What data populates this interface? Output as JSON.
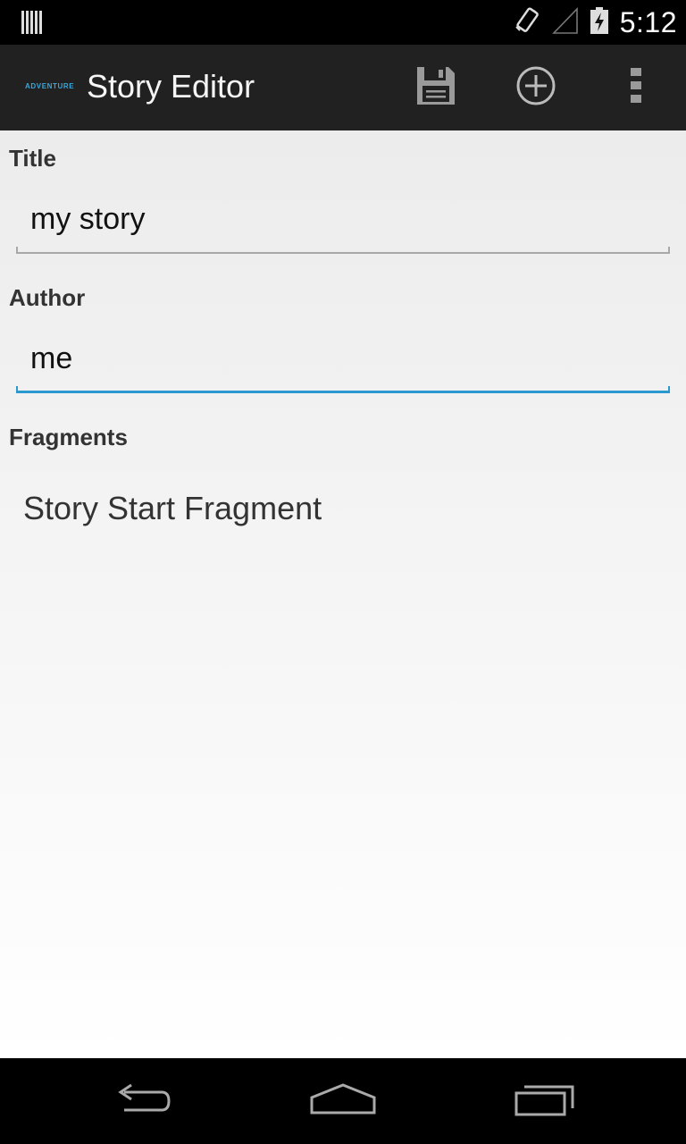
{
  "status_bar": {
    "time": "5:12",
    "icons": [
      "notification-icon",
      "vibrate-icon",
      "signal-icon",
      "battery-charging-icon"
    ]
  },
  "action_bar": {
    "logo_text": "ADVENTURE",
    "title": "Story Editor",
    "actions": [
      {
        "name": "save",
        "icon": "save-icon"
      },
      {
        "name": "add",
        "icon": "add-circle-icon"
      },
      {
        "name": "overflow",
        "icon": "overflow-menu-icon"
      }
    ]
  },
  "form": {
    "title_label": "Title",
    "title_value": "my story",
    "author_label": "Author",
    "author_value": "me",
    "fragments_label": "Fragments",
    "fragments": [
      "Story Start Fragment"
    ]
  },
  "nav_bar": {
    "buttons": [
      "back-icon",
      "home-icon",
      "recents-icon"
    ]
  },
  "colors": {
    "accent": "#2b98cf",
    "action_bar": "#212121",
    "logo": "#33a9e0"
  }
}
